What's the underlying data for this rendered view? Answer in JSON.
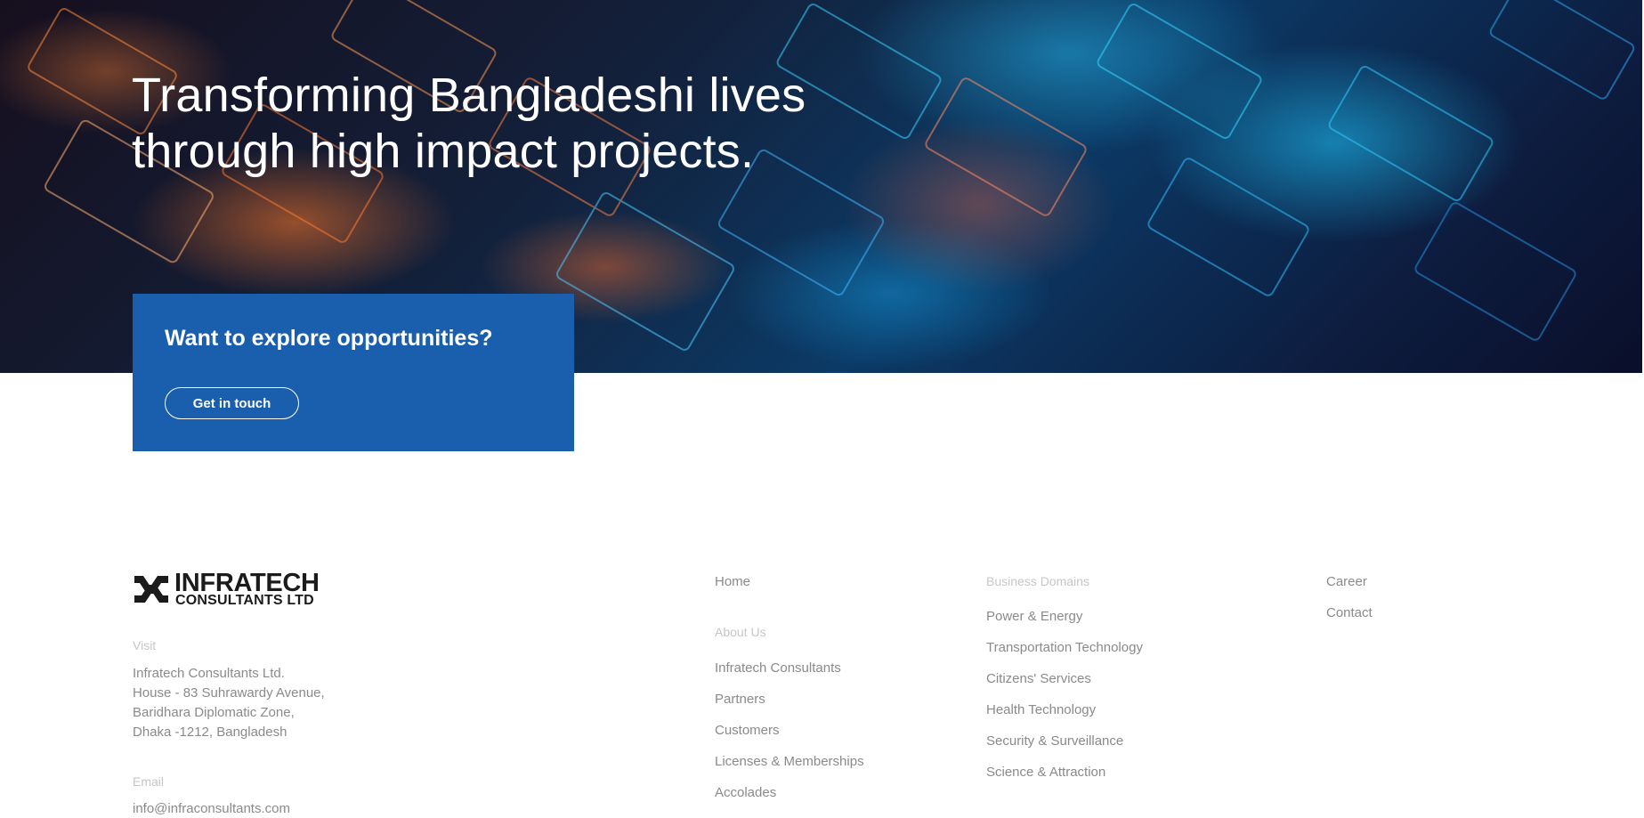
{
  "hero": {
    "title_line1": "Transforming Bangladeshi lives",
    "title_line2": "through high impact projects."
  },
  "cta": {
    "heading": "Want to explore opportunities?",
    "button_label": "Get in touch"
  },
  "footer": {
    "logo": {
      "line1": "INFRATECH",
      "line2": "CONSULTANTS LTD",
      "icon": "infratech-logo-mark"
    },
    "visit_label": "Visit",
    "address_lines": [
      "Infratech Consultants Ltd.",
      "House - 83 Suhrawardy Avenue,",
      "Baridhara Diplomatic Zone,",
      "Dhaka -1212, Bangladesh"
    ],
    "email_label": "Email",
    "email": "info@infraconsultants.com",
    "col1": {
      "home": "Home",
      "about_heading": "About Us",
      "about_items": [
        "Infratech Consultants",
        "Partners",
        "Customers",
        "Licenses & Memberships",
        "Accolades"
      ]
    },
    "col2": {
      "heading": "Business Domains",
      "items": [
        "Power & Energy",
        "Transportation Technology",
        "Citizens' Services",
        "Health Technology",
        "Security & Surveillance",
        "Science & Attraction"
      ]
    },
    "col3": {
      "items": [
        "Career",
        "Contact"
      ]
    }
  },
  "colors": {
    "cta_background": "#1a5fae",
    "footer_text": "#8a8a8a",
    "footer_muted": "#c6c6c6"
  }
}
